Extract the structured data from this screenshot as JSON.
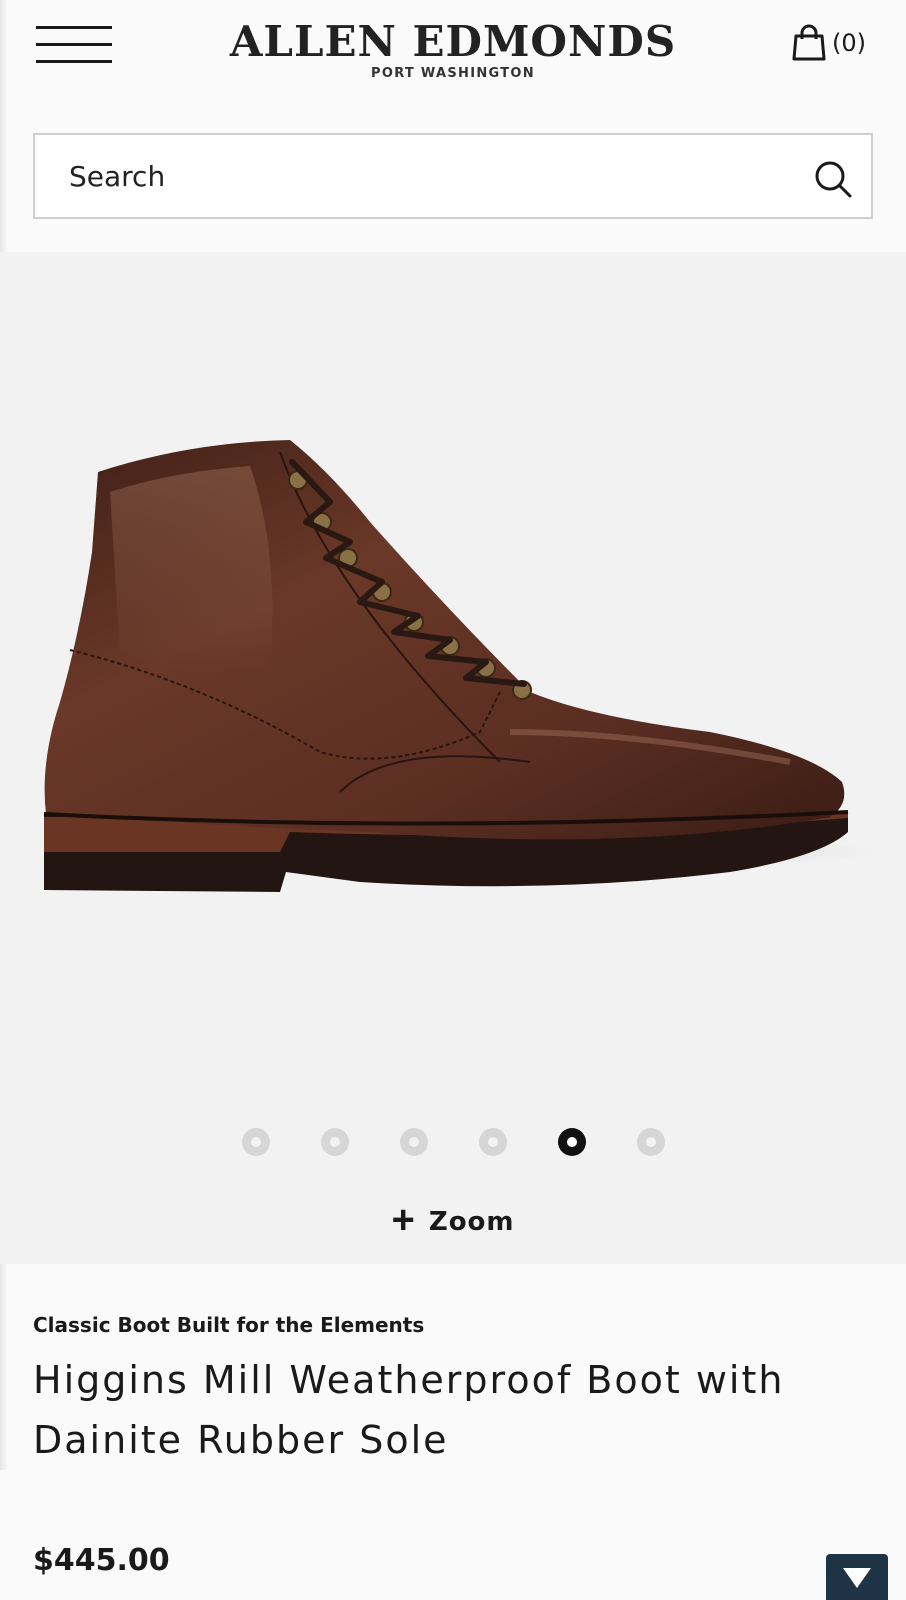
{
  "header": {
    "brand_name": "ALLEN EDMONDS",
    "brand_sub": "PORT WASHINGTON",
    "cart_count": "(0)"
  },
  "search": {
    "placeholder": "Search"
  },
  "gallery": {
    "image_alt": "brown leather lace-up boot",
    "slide_count": 6,
    "active_slide": 5,
    "zoom_label": "Zoom"
  },
  "product": {
    "tagline": "Classic Boot Built for the Elements",
    "title": "Higgins Mill Weatherproof Boot with Dainite Rubber Sole",
    "price": "$445.00"
  },
  "colors": {
    "background": "#fafafa",
    "gallery_bg": "#f2f2f2",
    "boot_leather": "#5a2e22",
    "scroll_button": "#1f3347"
  },
  "icons": [
    "hamburger-menu-icon",
    "shopping-bag-icon",
    "search-icon",
    "plus-icon",
    "chevron-down-icon"
  ]
}
